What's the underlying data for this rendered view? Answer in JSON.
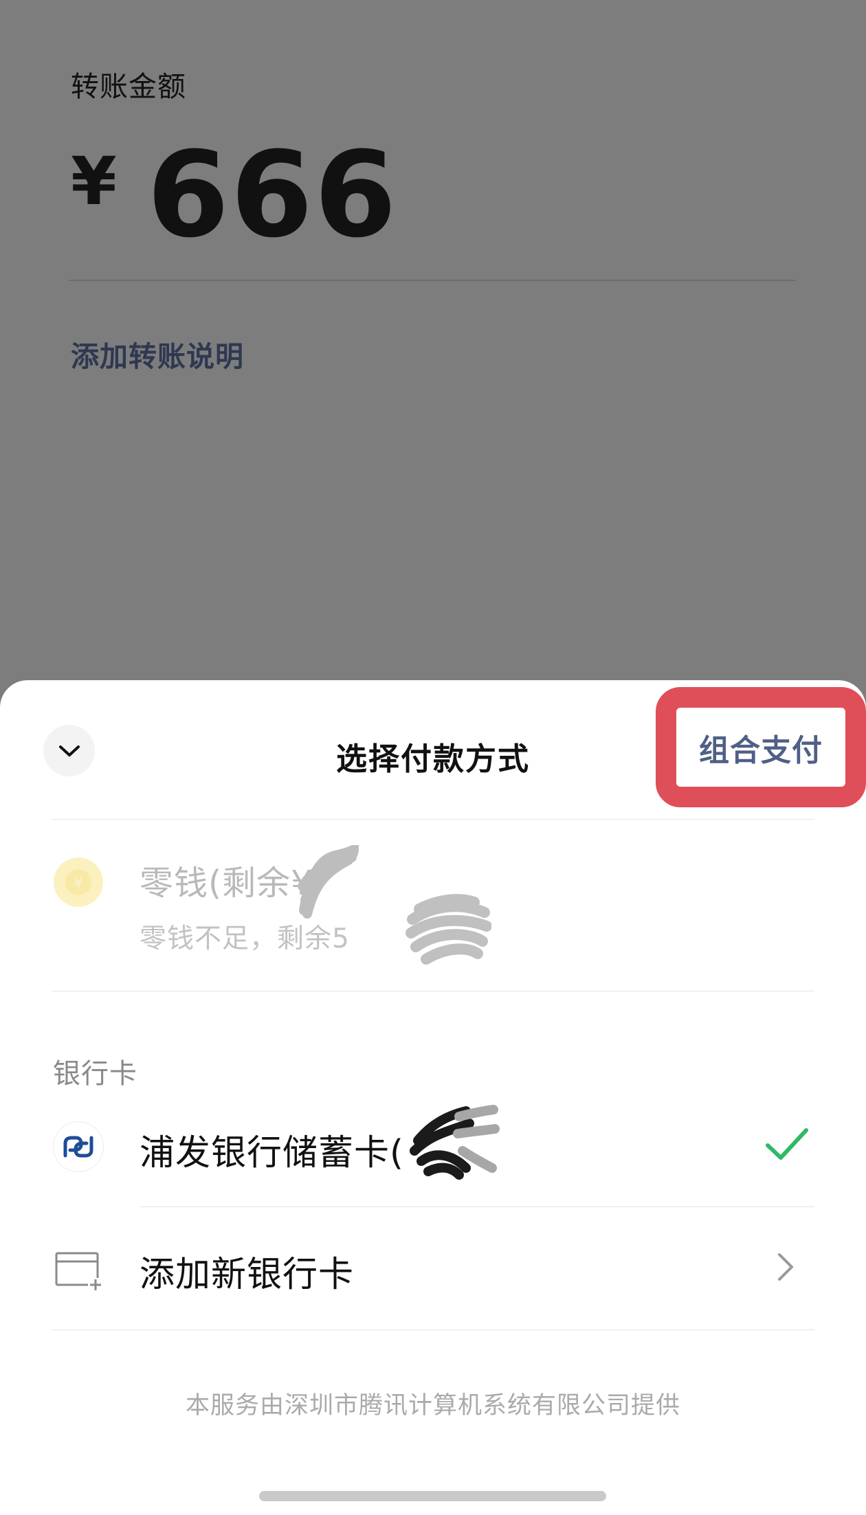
{
  "background": {
    "amount_label": "转账金额",
    "currency_symbol": "¥",
    "amount_value": "666",
    "add_note_link": "添加转账说明"
  },
  "sheet": {
    "title": "选择付款方式",
    "collapse_icon": "chevron-down-icon",
    "combo_pay_label": "组合支付",
    "highlight_color": "#de4f5a",
    "change_option": {
      "icon": "coin-icon",
      "title": "零钱(剩余¥",
      "subtitle": "零钱不足，剩余5",
      "disabled": true
    },
    "bank_section_label": "银行卡",
    "bank_card": {
      "icon": "spd-bank-logo-icon",
      "name": "浦发银行储蓄卡(",
      "selected": true,
      "check_color": "#2fb966"
    },
    "add_card": {
      "icon": "add-card-icon",
      "label": "添加新银行卡",
      "chevron_icon": "chevron-right-icon"
    },
    "footer_note": "本服务由深圳市腾讯计算机系统有限公司提供"
  }
}
